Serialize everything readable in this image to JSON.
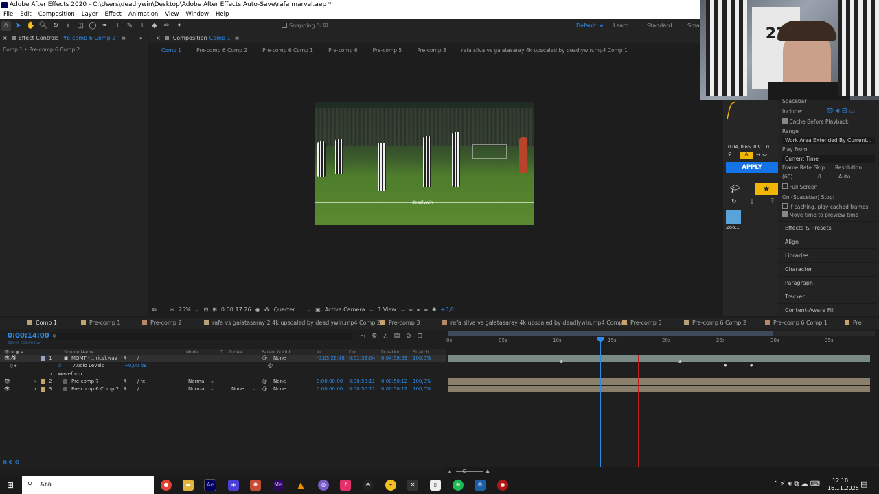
{
  "window": {
    "title": "Adobe After Effects 2020 - C:\\Users\\deadlywin\\Desktop\\Adobe After Effects Auto-Save\\rafa marvel.aep *"
  },
  "menu": [
    "File",
    "Edit",
    "Composition",
    "Layer",
    "Effect",
    "Animation",
    "View",
    "Window",
    "Help"
  ],
  "toolbar": {
    "snapping": "Snapping",
    "workspaces": {
      "default": "Default",
      "learn": "Learn",
      "standard": "Standard",
      "small": "Smal"
    }
  },
  "effect_controls": {
    "title": "Effect Controls",
    "layer": "Pre-comp 6 Comp 2",
    "breadcrumb": "Comp 1 • Pre-comp 6 Comp 2"
  },
  "composition": {
    "title": "Composition",
    "name": "Comp 1",
    "breadcrumbs": [
      "Comp 1",
      "Pre-comp 6 Comp 2",
      "Pre-comp 6 Comp 1",
      "Pre-comp 6",
      "Pre-comp 5",
      "Pre-comp 3",
      "rafa silva vs galatasaray 4k upscaled by deadlywin.mp4 Comp 1"
    ],
    "watermark": "deadlywin",
    "zoom": "25%",
    "timecode": "0:00:17:26",
    "resolution": "Quarter",
    "camera": "Active Camera",
    "view": "1 View",
    "exposure": "+0,0"
  },
  "preview": {
    "shortcut": "Spacebar",
    "include_label": "Include:",
    "cache_before_playback": "Cache Before Playback",
    "range_label": "Range",
    "range_value": "Work Area Extended By Current...",
    "play_from_label": "Play From",
    "play_from_value": "Current Time",
    "frame_rate_label": "Frame Rate",
    "skip_label": "Skip",
    "resolution_label": "Resolution",
    "frame_rate_value": "(60)",
    "skip_value": "0",
    "resolution_value": "Auto",
    "full_screen": "Full Screen",
    "on_stop_label": "On (Spacebar) Stop:",
    "if_caching": "If caching, play cached frames",
    "move_time": "Move time to preview time"
  },
  "panels": [
    "Effects & Presets",
    "Align",
    "Libraries",
    "Character",
    "Paragraph",
    "Tracker",
    "Content-Aware Fill"
  ],
  "ease_plugin": {
    "values": "0.04, 0.65, 0.91, 0.",
    "apply": "APPLY",
    "preset_label": "Zoo..."
  },
  "timeline": {
    "tabs": [
      "Comp 1",
      "Pre-comp 1",
      "Pre-comp 2",
      "rafa vs galatasaray 2 4k upscaled by deadlywin.mp4 Comp 2",
      "Pre-comp 3",
      "rafa silva vs galatasaray 4k upscaled by deadlywin.mp4 Comp 1",
      "Pre-comp 5",
      "Pre-comp 6 Comp 2",
      "Pre-comp 6 Comp 1",
      "Pre"
    ],
    "tab_colors": [
      "#b5a27a",
      "#c7a26b",
      "#b58a6b",
      "#b5a27a",
      "#c7a26b",
      "#b58a6b",
      "#c7a26b",
      "#b5a27a",
      "#b58a6b",
      "#c7a26b"
    ],
    "current_time": "0:00:14:00",
    "frame_sub": "00840 (60.00 fps)",
    "columns": {
      "source": "Source Name",
      "mode": "Mode",
      "t": "T",
      "trkmat": "TrkMat",
      "parent": "Parent & Link",
      "in": "In",
      "out": "Out",
      "duration": "Duration",
      "stretch": "Stretch"
    },
    "ruler": [
      "0s",
      "05s",
      "10s",
      "15s",
      "20s",
      "25s",
      "30s",
      "35s"
    ],
    "layers": [
      {
        "num": "1",
        "name": "MGMT - ...rics).wav",
        "mode": "",
        "trkmat": "",
        "parent": "None",
        "in": "-0:03:26:48",
        "out": "0:01:32:04",
        "duration": "0:04:58:53",
        "stretch": "100,0%"
      },
      {
        "num": "2",
        "name": "Pre-comp 7",
        "mode": "Normal",
        "trkmat": "",
        "parent": "None",
        "in": "0:00:00:00",
        "out": "0:00:50:11",
        "duration": "0:00:50:12",
        "stretch": "100,0%"
      },
      {
        "num": "3",
        "name": "Pre-comp 6 Comp 2",
        "mode": "Normal",
        "trkmat": "None",
        "parent": "None",
        "in": "0:00:00:00",
        "out": "0:00:50:11",
        "duration": "0:00:50:12",
        "stretch": "100,0%"
      }
    ],
    "audio_levels_label": "Audio Levels",
    "audio_levels_value": "+0,00 dB",
    "waveform_label": "Waveform"
  },
  "taskbar": {
    "search_placeholder": "Ara",
    "time": "12:10",
    "date": "16.11.2025"
  }
}
